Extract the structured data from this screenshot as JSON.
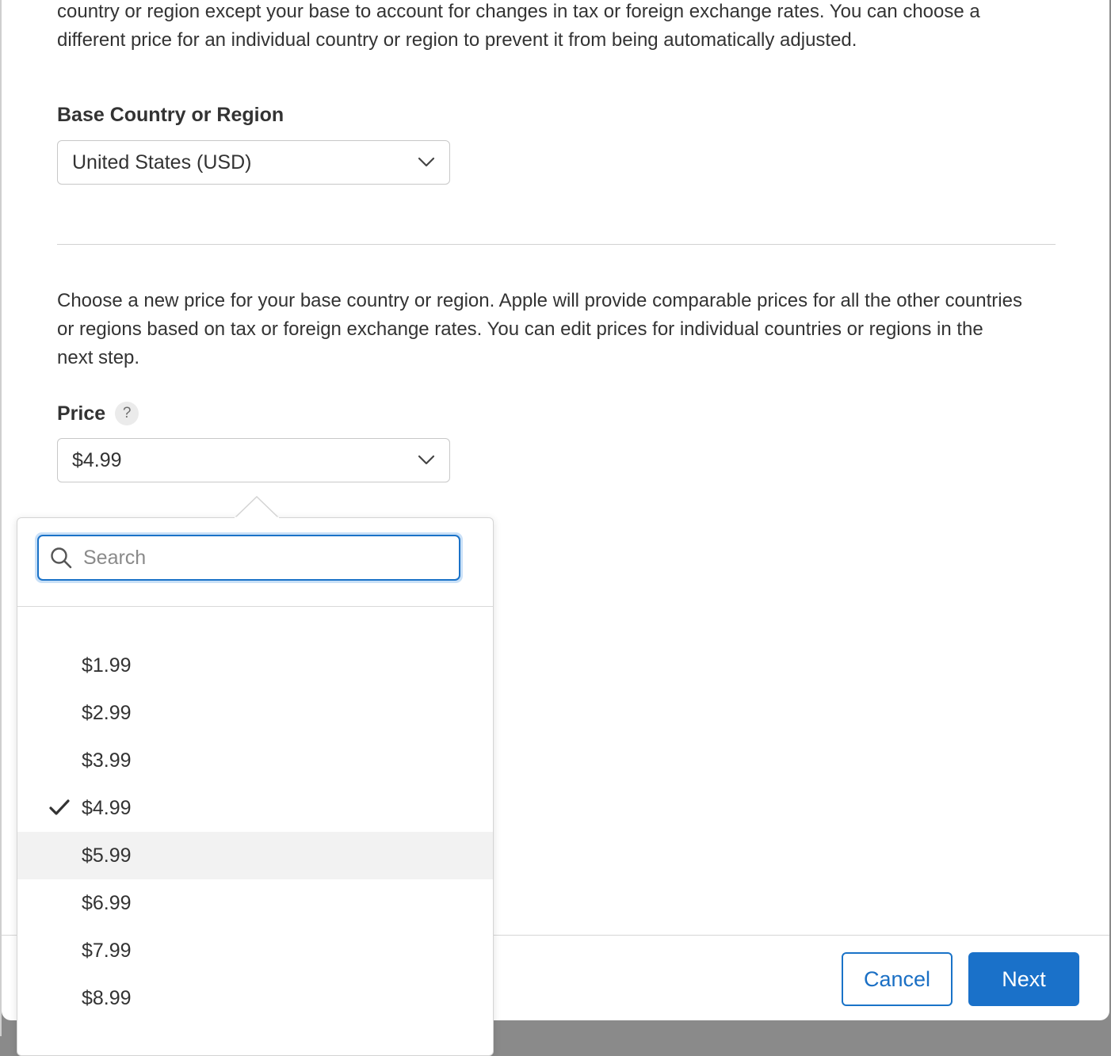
{
  "intro_text": "country or region except your base to account for changes in tax or foreign exchange rates. You can choose a different price for an individual country or region to prevent it from being automatically adjusted.",
  "base_country": {
    "label": "Base Country or Region",
    "value": "United States (USD)",
    "icon": "chevron-down-icon"
  },
  "price_intro_text": "Choose a new price for your base country or region. Apple will provide comparable prices for all the other countries or regions based on tax or foreign exchange rates. You can edit prices for individual countries or regions in the next step.",
  "price": {
    "label": "Price",
    "help_glyph": "?",
    "value": "$4.99",
    "icon": "chevron-down-icon"
  },
  "dropdown": {
    "search_placeholder": "Search",
    "search_value": "",
    "selected": "$4.99",
    "hovered": "$5.99",
    "options": [
      "$1.99",
      "$2.99",
      "$3.99",
      "$4.99",
      "$5.99",
      "$6.99",
      "$7.99",
      "$8.99"
    ]
  },
  "footer": {
    "cancel_label": "Cancel",
    "next_label": "Next"
  },
  "colors": {
    "accent": "#1a71c9",
    "text": "#333333",
    "hover_row": "#f2f2f2"
  }
}
